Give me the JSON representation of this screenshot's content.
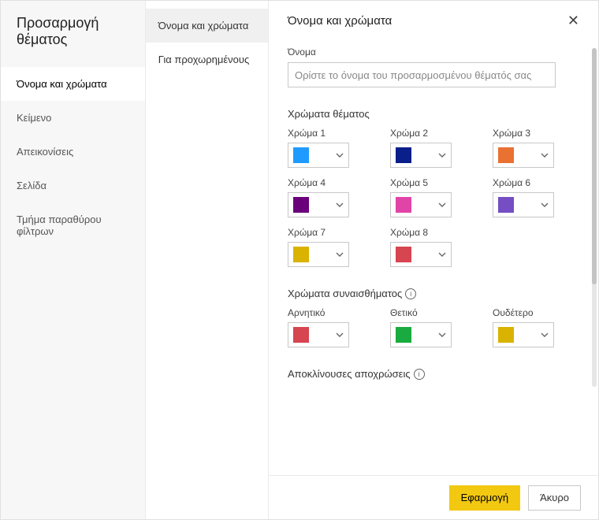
{
  "sidebar": {
    "title": "Προσαρμογή θέματος",
    "items": [
      {
        "label": "Όνομα και χρώματα"
      },
      {
        "label": "Κείμενο"
      },
      {
        "label": "Απεικονίσεις"
      },
      {
        "label": "Σελίδα"
      },
      {
        "label": "Τμήμα παραθύρου φίλτρων"
      }
    ]
  },
  "subnav": {
    "items": [
      {
        "label": "Όνομα και χρώματα"
      },
      {
        "label": "Για προχωρημένους"
      }
    ]
  },
  "main": {
    "title": "Όνομα και χρώματα",
    "name_label": "Όνομα",
    "name_placeholder": "Ορίστε το όνομα του προσαρμοσμένου θέματός σας",
    "theme_colors_title": "Χρώματα θέματος",
    "theme_colors": [
      {
        "label": "Χρώμα 1",
        "hex": "#1f9bff"
      },
      {
        "label": "Χρώμα 2",
        "hex": "#0b1f8a"
      },
      {
        "label": "Χρώμα 3",
        "hex": "#e97132"
      },
      {
        "label": "Χρώμα 4",
        "hex": "#6b007b"
      },
      {
        "label": "Χρώμα 5",
        "hex": "#e044a7"
      },
      {
        "label": "Χρώμα 6",
        "hex": "#744ec2"
      },
      {
        "label": "Χρώμα 7",
        "hex": "#d9b300"
      },
      {
        "label": "Χρώμα 8",
        "hex": "#d64550"
      }
    ],
    "sentiment_title": "Χρώματα συναισθήματος",
    "sentiment_colors": [
      {
        "label": "Αρνητικό",
        "hex": "#d64550"
      },
      {
        "label": "Θετικό",
        "hex": "#1aab40"
      },
      {
        "label": "Ουδέτερο",
        "hex": "#d9b300"
      }
    ],
    "divergent_title": "Αποκλίνουσες αποχρώσεις"
  },
  "footer": {
    "apply": "Εφαρμογή",
    "cancel": "Άκυρο"
  }
}
